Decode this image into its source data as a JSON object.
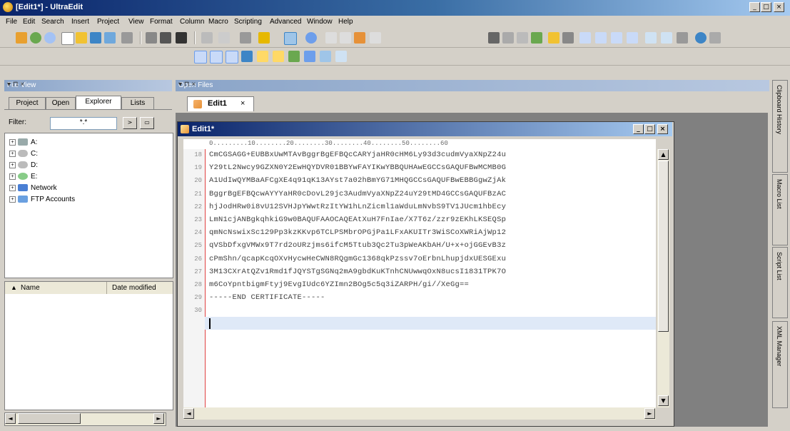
{
  "app": {
    "title": "[Edit1*] - UltraEdit"
  },
  "window_controls": {
    "minimize": "_",
    "maximize": "□",
    "close": "×"
  },
  "menu": [
    "File",
    "Edit",
    "Search",
    "Insert",
    "Project",
    "View",
    "Format",
    "Column",
    "Macro",
    "Scripting",
    "Advanced",
    "Window",
    "Help"
  ],
  "file_view": {
    "title": "File View",
    "controls": "▾ ⊓ ×",
    "tabs": [
      "Project",
      "Open",
      "Explorer",
      "Lists"
    ],
    "active_tab": "Explorer",
    "filter_label": "Filter:",
    "filter_value": "*.*",
    "tree": [
      {
        "label": "A:",
        "icon": "floppy-drive-icon"
      },
      {
        "label": "C:",
        "icon": "hard-drive-icon"
      },
      {
        "label": "D:",
        "icon": "hard-drive-icon"
      },
      {
        "label": "E:",
        "icon": "cd-drive-icon"
      },
      {
        "label": "Network",
        "icon": "network-icon"
      },
      {
        "label": "FTP Accounts",
        "icon": "ftp-icon"
      }
    ],
    "list_columns": [
      "Name",
      "Date modified"
    ]
  },
  "open_files": {
    "title": "Open Files",
    "controls": "▾ ⊓ ×",
    "tab_label": "Edit1",
    "tab_close": "×"
  },
  "editor": {
    "title": "Edit1*",
    "ruler": "0.........10........20........30........40........50........60",
    "lines": [
      {
        "n": "18",
        "text": "CmCGSAGG+EUBBxUwMTAvBggrBgEFBQcCARYjaHR0cHM6Ly93d3cudmVyaXNpZ24u"
      },
      {
        "n": "19",
        "text": "Y29tL2Nwcy9GZXN0Y2EwHQYDVR01BBYwFAYIKwYBBQUHAwEGCCsGAQUFBwMCMB0G"
      },
      {
        "n": "20",
        "text": "A1UdIwQYMBaAFCgXE4q91qK13AYst7a02hBmYG71MHQGCCsGAQUFBwEBBGgwZjAk"
      },
      {
        "n": "21",
        "text": "BggrBgEFBQcwAYYYaHR0cDovL29jc3AudmVyaXNpZ24uY29tMD4GCCsGAQUFBzAC"
      },
      {
        "n": "22",
        "text": "hjJodHRw0i8vU12SVHJpYWwtRzItYW1hLnZicml1aWduLmNvbS9TV1JUcm1hbEcy"
      },
      {
        "n": "23",
        "text": "LmN1cjANBgkqhkiG9w0BAQUFAAOCAQEAtXuH7FnIae/X7T6z/zzr9zEKhLKSEQSp"
      },
      {
        "n": "24",
        "text": "qmNcNswixSc129Pp3kzKKvp6TCLPSMbrOPGjPa1LFxAKUITr3WiSCoXWRiAjWp12"
      },
      {
        "n": "25",
        "text": "qVSbDfxgVMWx9T7rd2oURzjms6ifcM5Ttub3Qc2Tu3pWeAKbAH/U+x+ojGGEvB3z"
      },
      {
        "n": "26",
        "text": "cPmShn/qcapKcqOXvHycwHeCWN8RQgmGc1368qkPzssv7oErbnLhupjdxUESGExu"
      },
      {
        "n": "27",
        "text": "3M13CXrAtQZv1Rmd1fJQYSTgSGNq2mA9gbdKuKTnhCNUwwqOxN8ucsI1831TPK7O"
      },
      {
        "n": "28",
        "text": "m6CoYpntbigmFtyj9EvgIUdc6YZImn2BOg5c5q3iZARPH/gi//XeGg=="
      },
      {
        "n": "29",
        "text": "-----END CERTIFICATE-----"
      },
      {
        "n": "30",
        "text": ""
      }
    ]
  },
  "docked_tabs": [
    "Clipboard History",
    "Macro List",
    "Script List",
    "XML Manager"
  ],
  "colors": {
    "title_start": "#0a246a",
    "title_end": "#a6caf0",
    "current_line": "#dfe9f7",
    "gutter_border": "#e04040"
  }
}
